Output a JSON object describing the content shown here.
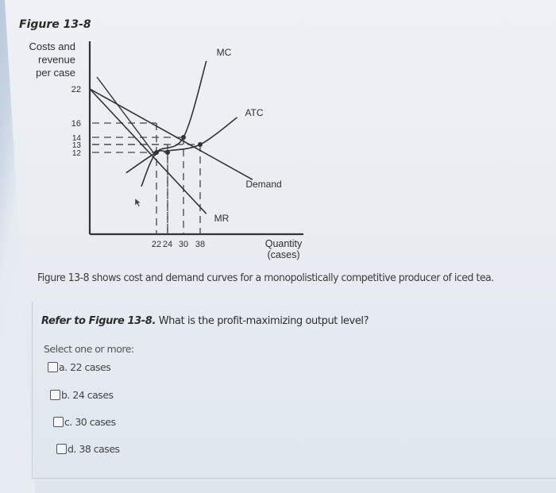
{
  "figure": {
    "title": "Figure 13-8",
    "caption": "Figure 13-8 shows cost and demand curves for a monopolistically competitive producer of iced tea."
  },
  "chart_data": {
    "type": "line",
    "title": "Figure 13-8",
    "ylabel_lines": [
      "Costs and",
      "revenue",
      "per case"
    ],
    "xlabel_lines": [
      "Quantity",
      "(cases)"
    ],
    "y_ticks": [
      22,
      16,
      14,
      13,
      12
    ],
    "x_ticks": [
      22,
      24,
      30,
      38
    ],
    "series": [
      {
        "name": "Demand",
        "label": "Demand",
        "points": [
          [
            0,
            22
          ],
          [
            24,
            16
          ],
          [
            38,
            13
          ],
          [
            55,
            8
          ]
        ]
      },
      {
        "name": "MR",
        "label": "MR",
        "points": [
          [
            0,
            22
          ],
          [
            22,
            12
          ],
          [
            40,
            3
          ]
        ]
      },
      {
        "name": "MC",
        "label": "MC",
        "points": [
          [
            17,
            7
          ],
          [
            22,
            12
          ],
          [
            30,
            14
          ],
          [
            40,
            28
          ]
        ]
      },
      {
        "name": "ATC",
        "label": "ATC",
        "points": [
          [
            12,
            9
          ],
          [
            22,
            12
          ],
          [
            24,
            12.2
          ],
          [
            38,
            13
          ],
          [
            50,
            17
          ]
        ]
      }
    ],
    "marked_points": [
      {
        "x": 22,
        "y": 12
      },
      {
        "x": 24,
        "y": 12
      },
      {
        "x": 30,
        "y": 14
      },
      {
        "x": 38,
        "y": 13
      }
    ],
    "guide_lines": [
      {
        "x": 22,
        "y": 16
      },
      {
        "x": 24,
        "y": 12
      },
      {
        "x": 30,
        "y": 14
      },
      {
        "x": 38,
        "y": 13
      },
      {
        "x": 24,
        "y": 13
      }
    ]
  },
  "question": {
    "prefix": "Refer to Figure 13-8.",
    "text": " What is the profit-maximizing output level?",
    "hint": "Select one or more:",
    "options": [
      {
        "letter": "a.",
        "label": "22 cases",
        "checked": false
      },
      {
        "letter": "b.",
        "label": "24 cases",
        "checked": false
      },
      {
        "letter": "c.",
        "label": "30 cases",
        "checked": false
      },
      {
        "letter": "d.",
        "label": "38 cases",
        "checked": false
      }
    ]
  }
}
